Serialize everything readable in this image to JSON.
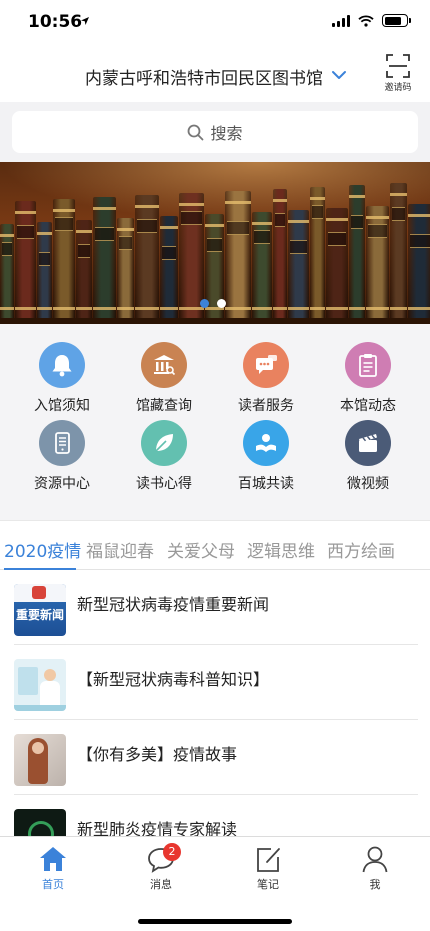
{
  "status_bar": {
    "time": "10:56"
  },
  "header": {
    "library_name": "内蒙古呼和浩特市回民区图书馆",
    "invite_label": "邀请码"
  },
  "search": {
    "placeholder": "搜索"
  },
  "banner": {
    "slide_count": 2,
    "active_slide": 1
  },
  "features": [
    {
      "label": "入馆须知",
      "icon": "bell-icon",
      "color": "#5fa3e6"
    },
    {
      "label": "馆藏查询",
      "icon": "library-building-icon",
      "color": "#c98352"
    },
    {
      "label": "读者服务",
      "icon": "chat-icon",
      "color": "#e9825f"
    },
    {
      "label": "本馆动态",
      "icon": "clipboard-icon",
      "color": "#cf7db3"
    },
    {
      "label": "资源中心",
      "icon": "phone-icon",
      "color": "#7d94aa"
    },
    {
      "label": "读书心得",
      "icon": "leaf-icon",
      "color": "#63c0b0"
    },
    {
      "label": "百城共读",
      "icon": "reader-icon",
      "color": "#39a5e8"
    },
    {
      "label": "微视频",
      "icon": "clapperboard-icon",
      "color": "#4b5b77"
    }
  ],
  "category_tabs": [
    "2020疫情",
    "福鼠迎春",
    "关爱父母",
    "逻辑思维",
    "西方绘画"
  ],
  "active_tab": 0,
  "news": [
    {
      "title": "新型冠状病毒疫情重要新闻",
      "thumb_text": "重要新闻"
    },
    {
      "title": "【新型冠状病毒科普知识】"
    },
    {
      "title": "【你有多美】疫情故事"
    },
    {
      "title": "新型肺炎疫情专家解读"
    }
  ],
  "tabbar": {
    "items": [
      {
        "label": "首页",
        "icon": "home-icon"
      },
      {
        "label": "消息",
        "icon": "message-icon",
        "badge": "2"
      },
      {
        "label": "笔记",
        "icon": "note-icon"
      },
      {
        "label": "我",
        "icon": "profile-icon"
      }
    ],
    "active": 0
  },
  "colors": {
    "accent": "#3b82d9",
    "badge": "#e8362f"
  }
}
